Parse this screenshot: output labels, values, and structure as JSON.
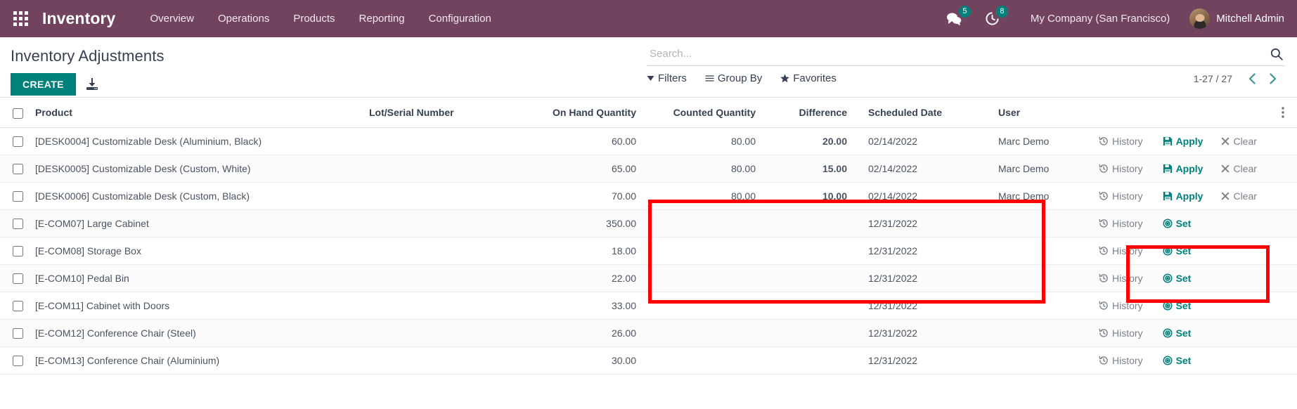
{
  "navbar": {
    "apps_icon": "apps-grid-icon",
    "brand": "Inventory",
    "menu": [
      {
        "label": "Overview"
      },
      {
        "label": "Operations"
      },
      {
        "label": "Products"
      },
      {
        "label": "Reporting"
      },
      {
        "label": "Configuration"
      }
    ],
    "messages": {
      "icon": "chat-bubbles-icon",
      "count": "5"
    },
    "activities": {
      "icon": "clock-activity-icon",
      "count": "8"
    },
    "company": "My Company (San Francisco)",
    "user": "Mitchell Admin",
    "accent_color": "#71435f",
    "badge_color": "#00807b"
  },
  "control_panel": {
    "title": "Inventory Adjustments",
    "create_label": "CREATE",
    "import_icon": "import-download-icon",
    "create_color": "#00807b"
  },
  "search": {
    "placeholder": "Search...",
    "value": "",
    "search_icon": "search-icon"
  },
  "filters": [
    {
      "label": "Filters",
      "icon": "filter-caret-icon"
    },
    {
      "label": "Group By",
      "icon": "group-by-lines-icon"
    },
    {
      "label": "Favorites",
      "icon": "star-icon"
    }
  ],
  "pager": {
    "range": "1-27 / 27",
    "prev_icon": "chevron-left-icon",
    "next_icon": "chevron-right-icon",
    "arrow_color": "#4a9b9b"
  },
  "table": {
    "columns": [
      "Product",
      "Lot/Serial Number",
      "On Hand Quantity",
      "Counted Quantity",
      "Difference",
      "Scheduled Date",
      "User"
    ],
    "optional_columns_icon": "vertical-dots-icon",
    "select_all_checkbox": false,
    "rows": [
      {
        "checked": false,
        "product": "[DESK0004] Customizable Desk (Aluminium, Black)",
        "lot": "",
        "on_hand": "60.00",
        "counted": "80.00",
        "difference": "20.00",
        "difference_positive": true,
        "scheduled_date": "02/14/2022",
        "user": "Marc Demo",
        "actions": [
          "History",
          "Apply",
          "Clear"
        ]
      },
      {
        "checked": false,
        "product": "[DESK0005] Customizable Desk (Custom, White)",
        "lot": "",
        "on_hand": "65.00",
        "counted": "80.00",
        "difference": "15.00",
        "difference_positive": true,
        "scheduled_date": "02/14/2022",
        "user": "Marc Demo",
        "actions": [
          "History",
          "Apply",
          "Clear"
        ]
      },
      {
        "checked": false,
        "product": "[DESK0006] Customizable Desk (Custom, Black)",
        "lot": "",
        "on_hand": "70.00",
        "counted": "80.00",
        "difference": "10.00",
        "difference_positive": true,
        "scheduled_date": "02/14/2022",
        "user": "Marc Demo",
        "actions": [
          "History",
          "Apply",
          "Clear"
        ]
      },
      {
        "checked": false,
        "product": "[E-COM07] Large Cabinet",
        "lot": "",
        "on_hand": "350.00",
        "counted": "",
        "difference": "",
        "difference_positive": false,
        "scheduled_date": "12/31/2022",
        "user": "",
        "actions": [
          "History",
          "Set"
        ]
      },
      {
        "checked": false,
        "product": "[E-COM08] Storage Box",
        "lot": "",
        "on_hand": "18.00",
        "counted": "",
        "difference": "",
        "difference_positive": false,
        "scheduled_date": "12/31/2022",
        "user": "",
        "actions": [
          "History",
          "Set"
        ]
      },
      {
        "checked": false,
        "product": "[E-COM10] Pedal Bin",
        "lot": "",
        "on_hand": "22.00",
        "counted": "",
        "difference": "",
        "difference_positive": false,
        "scheduled_date": "12/31/2022",
        "user": "",
        "actions": [
          "History",
          "Set"
        ]
      },
      {
        "checked": false,
        "product": "[E-COM11] Cabinet with Doors",
        "lot": "",
        "on_hand": "33.00",
        "counted": "",
        "difference": "",
        "difference_positive": false,
        "scheduled_date": "12/31/2022",
        "user": "",
        "actions": [
          "History",
          "Set"
        ]
      },
      {
        "checked": false,
        "product": "[E-COM12] Conference Chair (Steel)",
        "lot": "",
        "on_hand": "26.00",
        "counted": "",
        "difference": "",
        "difference_positive": false,
        "scheduled_date": "12/31/2022",
        "user": "",
        "actions": [
          "History",
          "Set"
        ]
      },
      {
        "checked": false,
        "product": "[E-COM13] Conference Chair (Aluminium)",
        "lot": "",
        "on_hand": "30.00",
        "counted": "",
        "difference": "",
        "difference_positive": false,
        "scheduled_date": "12/31/2022",
        "user": "",
        "actions": [
          "History",
          "Set"
        ]
      }
    ]
  },
  "annotations": {
    "color": "#ff0000",
    "boxes": [
      {
        "name": "counted-difference-date-user-columns"
      },
      {
        "name": "apply-clear-action-buttons"
      }
    ]
  }
}
